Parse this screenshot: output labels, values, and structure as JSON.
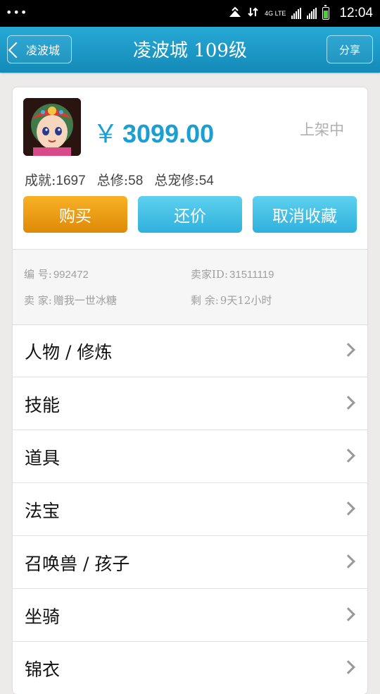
{
  "status_bar": {
    "dots": "•••",
    "network_label": "4G LTE",
    "time": "12:04"
  },
  "header": {
    "back_label": "凌波城",
    "title": "凌波城 109级",
    "share_label": "分享"
  },
  "listing": {
    "avatar_icon": "character-portrait-icon",
    "currency": "￥",
    "price": "3099.00",
    "status": "上架中",
    "stats": [
      {
        "label": "成就:",
        "value": "1697"
      },
      {
        "label": "总修:",
        "value": "58"
      },
      {
        "label": "总宠修:",
        "value": "54"
      }
    ],
    "buttons": {
      "buy": "购买",
      "bargain": "还价",
      "unfavorite": "取消收藏"
    },
    "info": {
      "id_label": "编 号:",
      "id_value": "992472",
      "seller_id_label": "卖家ID:",
      "seller_id_value": "31511119",
      "seller_label": "卖 家:",
      "seller_value": "赠我一世冰糖",
      "remaining_label": "剩 余:",
      "remaining_value": "9天12小时"
    },
    "colors": {
      "price": "#1b9fd3",
      "buy_button": "#f0a01a",
      "secondary_button": "#3fbfe6",
      "header": "#1b9fd3"
    }
  },
  "menu": [
    {
      "label": "人物 / 修炼"
    },
    {
      "label": "技能"
    },
    {
      "label": "道具"
    },
    {
      "label": "法宝"
    },
    {
      "label": "召唤兽 / 孩子"
    },
    {
      "label": "坐骑"
    },
    {
      "label": "锦衣"
    }
  ]
}
